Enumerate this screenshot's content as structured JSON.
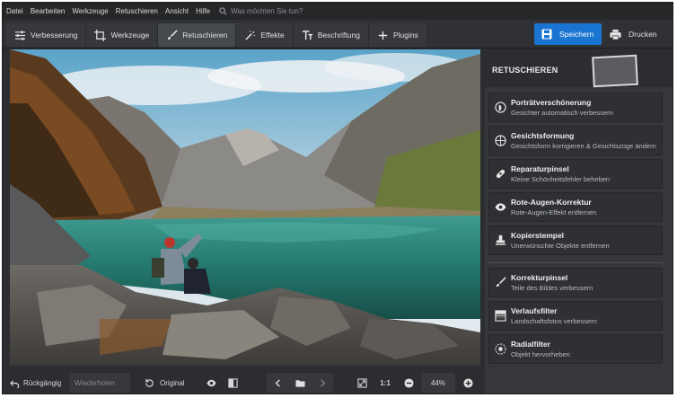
{
  "menu": [
    "Datei",
    "Bearbeiten",
    "Werkzeuge",
    "Retuschieren",
    "Ansicht",
    "Hilfe"
  ],
  "search_placeholder": "Was möchten Sie tun?",
  "tabs": [
    {
      "label": "Verbesserung",
      "icon": "sliders-icon"
    },
    {
      "label": "Werkzeuge",
      "icon": "crop-icon"
    },
    {
      "label": "Retuschieren",
      "icon": "brush-icon",
      "active": true
    },
    {
      "label": "Effekte",
      "icon": "magic-wand-icon"
    },
    {
      "label": "Beschriftung",
      "icon": "text-icon"
    },
    {
      "label": "Plugins",
      "icon": "plus-icon"
    }
  ],
  "save_label": "Speichern",
  "print_label": "Drucken",
  "colors": {
    "accent": "#1a74d1",
    "panel": "#35373b",
    "background": "#2b2d30"
  },
  "panel": {
    "title": "RETUSCHIEREN",
    "tools": [
      {
        "title": "Porträtverschönerung",
        "desc": "Gesichter automatisch verbessern",
        "icon": "portrait-icon"
      },
      {
        "title": "Gesichtsformung",
        "desc": "Gesichtsform korrigieren & Gesichtszüge ändern",
        "icon": "face-shape-icon"
      },
      {
        "title": "Reparaturpinsel",
        "desc": "Kleine Schönheitsfehler beheben",
        "icon": "bandage-icon"
      },
      {
        "title": "Rote-Augen-Korrektur",
        "desc": "Rote-Augen-Effekt entfernen",
        "icon": "eye-icon"
      },
      {
        "title": "Kopierstempel",
        "desc": "Unerwünschte Objekte entfernen",
        "icon": "stamp-icon"
      },
      {
        "title": "Korrekturpinsel",
        "desc": "Teile des Bildes verbessern",
        "icon": "brush-icon"
      },
      {
        "title": "Verlaufsfilter",
        "desc": "Landschaftsfotos verbessern",
        "icon": "gradient-icon"
      },
      {
        "title": "Radialfilter",
        "desc": "Objekt hervorheben",
        "icon": "radial-icon"
      }
    ]
  },
  "bottom": {
    "undo": "Rückgängig",
    "redo": "Wiederholen",
    "original": "Original",
    "ratio": "1:1",
    "zoom": "44%"
  }
}
